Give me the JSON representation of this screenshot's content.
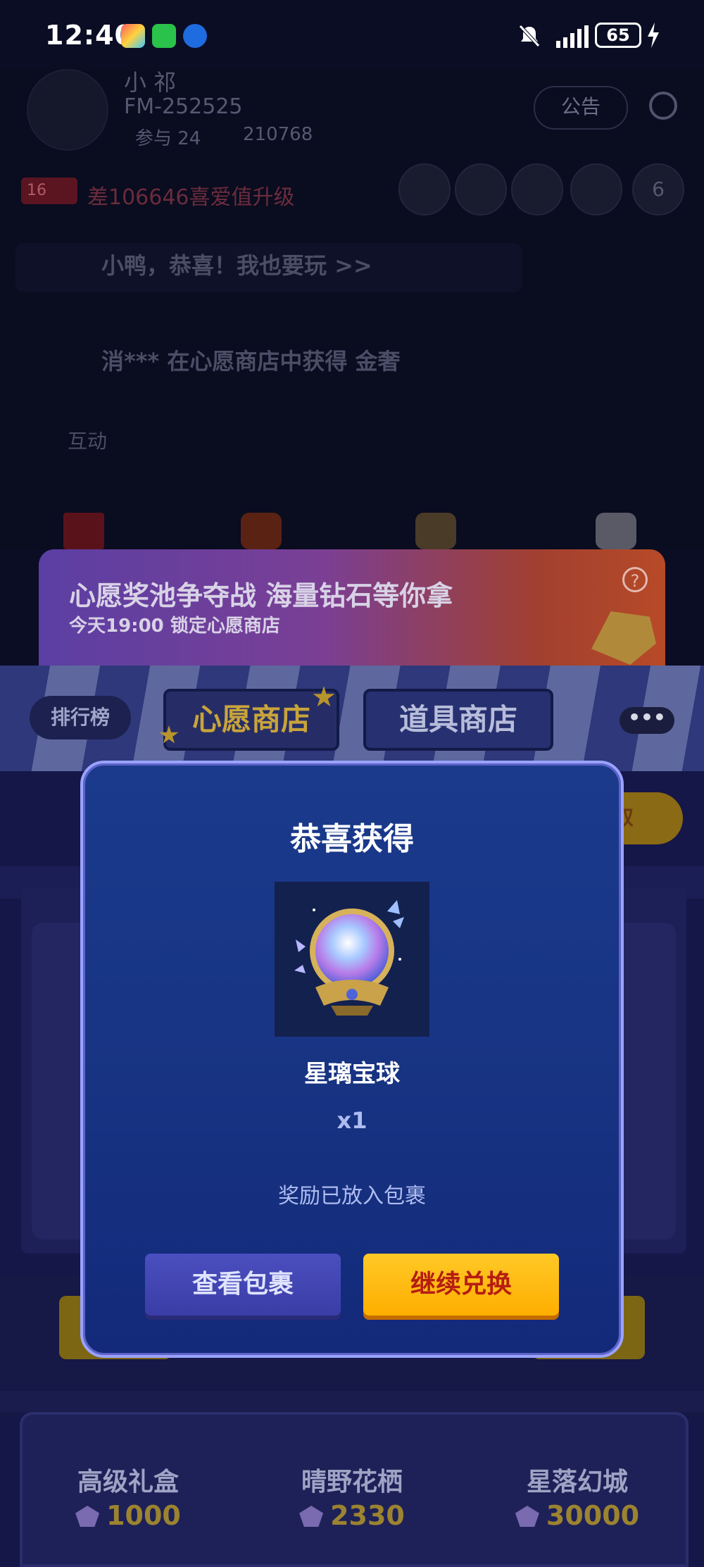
{
  "status_bar": {
    "time": "12:40",
    "battery": "65"
  },
  "room": {
    "host_name": "小 祁",
    "room_id": "FM-252525",
    "participants": "参与 24",
    "heat": "210768",
    "announce_label": "公告",
    "level_badge": "16",
    "upgrade_hint": "差106646喜爱值升级",
    "online_count": "6",
    "chat_line_1": "小鸭，恭喜！我也要玩 >>",
    "chat_line_2": "消*** 在心愿商店中获得 金奢",
    "interact_label": "互动"
  },
  "banner": {
    "title": "心愿奖池争夺战 海量钻石等你拿",
    "subtitle": "今天19:00 锁定心愿商店",
    "help_icon": "?"
  },
  "tabs": {
    "ranking": "排行榜",
    "wish_shop": "心愿商店",
    "item_shop": "道具商店",
    "more": "•••",
    "claim_partial": "取"
  },
  "modal": {
    "title": "恭喜获得",
    "prize_name": "星璃宝球",
    "prize_qty": "x1",
    "note": "奖励已放入包裹",
    "view_button": "查看包裹",
    "continue_button": "继续兑换"
  },
  "products": [
    {
      "name": "高级礼盒",
      "price": "1000"
    },
    {
      "name": "晴野花栖",
      "price": "2330"
    },
    {
      "name": "星落幻城",
      "price": "30000"
    }
  ],
  "colors": {
    "modal_border": "#9aa3ff",
    "continue_button": "#ffb800",
    "continue_text": "#b51d12",
    "view_button": "#4145b0",
    "active_tab_text": "#c9a43a"
  }
}
